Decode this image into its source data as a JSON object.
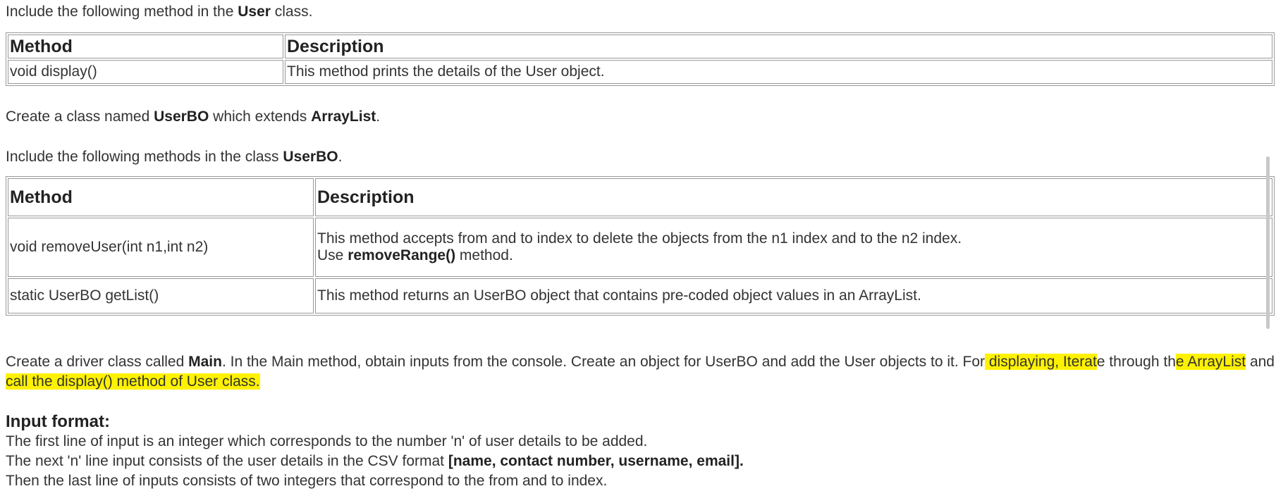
{
  "intro1": {
    "pre": "Include the following method in the ",
    "bold": "User",
    "post": " class."
  },
  "table1": {
    "headers": [
      "Method",
      "Description"
    ],
    "rows": [
      [
        "void display()",
        "This method prints the details of the User object."
      ]
    ]
  },
  "intro2": {
    "pre": "Create a class named ",
    "bold1": "UserBO",
    "mid": " which extends ",
    "bold2": "ArrayList",
    "post": "."
  },
  "intro3": {
    "pre": "Include the following methods in the class ",
    "bold": "UserBO",
    "post": "."
  },
  "table2": {
    "headers": [
      "Method",
      "Description"
    ],
    "row1": {
      "method": "void removeUser(int n1,int n2)",
      "desc_line1": "This method accepts from and to index to delete the objects from the n1 index and to the n2 index.",
      "desc_pre": "Use ",
      "desc_bold": "removeRange()",
      "desc_post": " method."
    },
    "row2": {
      "method": "static UserBO getList()",
      "desc": "This method returns an UserBO object that contains pre-coded object values in an ArrayList."
    }
  },
  "driver": {
    "t1": "Create a driver class called ",
    "b1": "Main",
    "t2": ". In the Main method, obtain inputs from the console. Create an object for UserBO and add the User objects to it. For",
    "h1": " displaying, Iterat",
    "t3": "e through th",
    "h2": "e ArrayList",
    "t4": " and ",
    "h3": "call the display() method of User class.",
    "t5": ""
  },
  "input_format": {
    "heading": "Input format:",
    "line1": "The first line of input is an integer which corresponds to the number 'n' of user details to be added.",
    "line2_pre": "The next 'n' line input consists of the user details in the CSV format ",
    "line2_bold": "[name, contact number, username, email].",
    "line3": "Then the last line of inputs consists of two integers that correspond to the from and to index."
  }
}
